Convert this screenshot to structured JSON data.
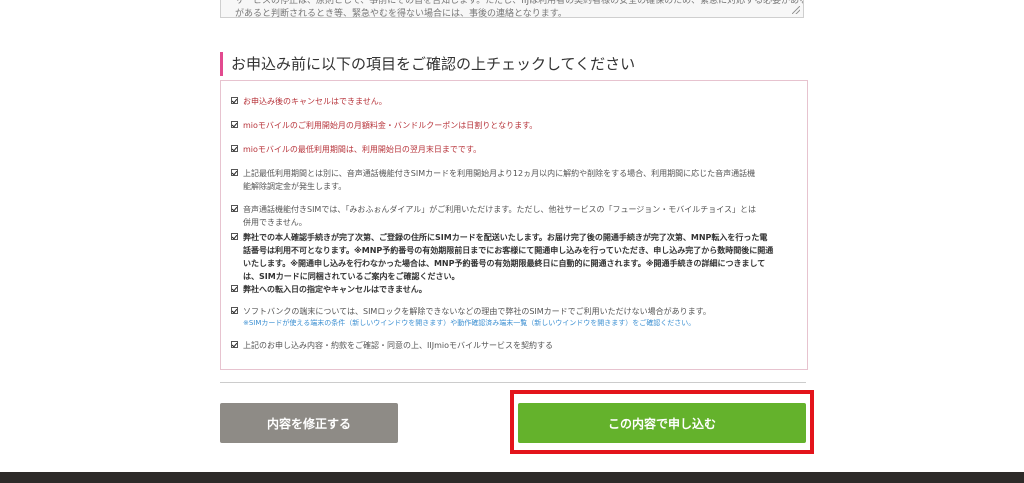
{
  "top_notice": {
    "line1": "サービスの停止は、原則として、事前にその旨を告知します。ただし、IIJは利用者の契約者様の安全の確保のため、緊急に対応する必要がある場合は告知なく停止・変更…",
    "line2": "があると判断されるとき等、緊急やむを得ない場合には、事後の連絡となります。"
  },
  "section": {
    "title": "お申込み前に以下の項目をご確認の上チェックしてください"
  },
  "checklist": [
    {
      "lines": [
        "お申込み後のキャンセルはできません。"
      ]
    },
    {
      "lines": [
        "mioモバイルのご利用開始月の月額料金・バンドルクーポンは日割りとなります。"
      ]
    },
    {
      "lines": [
        "mioモバイルの最低利用期間は、利用開始日の翌月末日までです。"
      ]
    },
    {
      "lines": [
        "上記最低利用期間とは別に、音声通話機能付きSIMカードを利用開始月より12ヵ月以内に解約や削除をする場合、利用期間に応じた音声通話機",
        "能解除調定金が発生します。"
      ]
    },
    {
      "lines": [
        "音声通話機能付きSIMでは、「みおふぉんダイアル」がご利用いただけます。ただし、他社サービスの「フュージョン・モバイルチョイス」とは",
        "併用できません。"
      ]
    },
    {
      "lines": [
        "弊社での本人確認手続きが完了次第、ご登録の住所にSIMカードを配送いたします。お届け完了後の開通手続きが完了次第、MNP転入を行った電",
        "話番号は利用不可となります。※MNP予約番号の有効期限前日までにお客様にて開通申し込みを行っていただき、申し込み完了から数時間後に開通",
        "いたします。※開通申し込みを行わなかった場合は、MNP予約番号の有効期限最終日に自動的に開通されます。※開通手続きの詳細につきまして",
        "は、SIMカードに同梱されているご案内をご確認ください。"
      ]
    },
    {
      "lines": [
        "弊社への転入日の指定やキャンセルはできません。"
      ]
    },
    {
      "lines": [
        "ソフトバンクの端末については、SIMロックを解除できないなどの理由で弊社のSIMカードでご利用いただけない場合があります。"
      ],
      "note": "※SIMカードが使える端末の条件（新しいウインドウを開きます）や動作確認済み端末一覧（新しいウインドウを開きます）をご確認ください。"
    },
    {
      "lines": [
        "上記のお申し込み内容・約款をご確認・同意の上、IIJmioモバイルサービスを契約する"
      ]
    }
  ],
  "buttons": {
    "modify": "内容を修正する",
    "submit": "この内容で申し込む"
  },
  "colors": {
    "accent_pink": "#e24a8f",
    "submit_green": "#64b22c",
    "modify_gray": "#8e8b86",
    "highlight_red": "#e3141b",
    "footer_dark": "#2d2a28"
  }
}
